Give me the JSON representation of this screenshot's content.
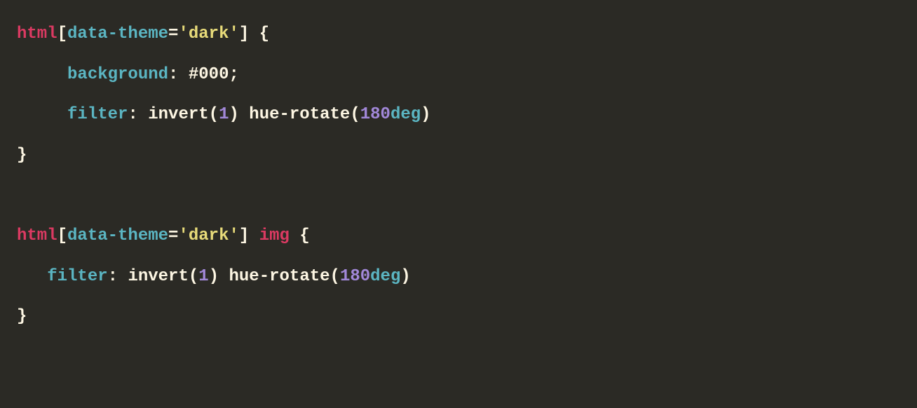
{
  "code": {
    "rule1": {
      "selector_tag": "html",
      "attr_open": "[",
      "attr_name": "data-theme",
      "attr_eq": "=",
      "attr_quote1": "'",
      "attr_value": "dark",
      "attr_quote2": "'",
      "attr_close": "]",
      "space": " ",
      "brace_open": "{",
      "prop1_name": "background",
      "prop1_colon": ":",
      "prop1_value": " #000",
      "prop1_semi": ";",
      "prop2_name": "filter",
      "prop2_colon": ":",
      "prop2_func1": " invert",
      "prop2_paren1o": "(",
      "prop2_num1": "1",
      "prop2_paren1c": ")",
      "prop2_func2": " hue-rotate",
      "prop2_paren2o": "(",
      "prop2_num2": "180",
      "prop2_unit2": "deg",
      "prop2_paren2c": ")",
      "brace_close": "}"
    },
    "rule2": {
      "selector_tag": "html",
      "attr_open": "[",
      "attr_name": "data-theme",
      "attr_eq": "=",
      "attr_quote1": "'",
      "attr_value": "dark",
      "attr_quote2": "'",
      "attr_close": "]",
      "space": " ",
      "selector_tag2": "img",
      "space2": " ",
      "brace_open": "{",
      "prop1_name": "filter",
      "prop1_colon": ":",
      "prop1_func1": " invert",
      "prop1_paren1o": "(",
      "prop1_num1": "1",
      "prop1_paren1c": ")",
      "prop1_func2": " hue-rotate",
      "prop1_paren2o": "(",
      "prop1_num2": "180",
      "prop1_unit2": "deg",
      "prop1_paren2c": ")",
      "brace_close": "}"
    }
  }
}
